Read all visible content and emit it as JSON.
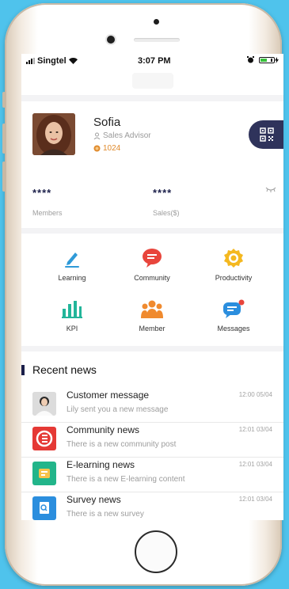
{
  "status": {
    "carrier": "Singtel",
    "time": "3:07 PM"
  },
  "profile": {
    "name": "Sofia",
    "role": "Sales Advisor",
    "points": "1024",
    "members_value": "****",
    "members_label": "Members",
    "sales_value": "****",
    "sales_label": "Sales($)"
  },
  "menu": [
    {
      "label": "Learning",
      "icon": "pencil-icon",
      "color": "#2f9ad8"
    },
    {
      "label": "Community",
      "icon": "chat-bubble-icon",
      "color": "#e8453c"
    },
    {
      "label": "Productivity",
      "icon": "badge-icon",
      "color": "#f4b820"
    },
    {
      "label": "KPI",
      "icon": "bar-chart-icon",
      "color": "#22b59a"
    },
    {
      "label": "Member",
      "icon": "people-icon",
      "color": "#f08a2e"
    },
    {
      "label": "Messages",
      "icon": "message-icon",
      "color": "#2b8ede"
    }
  ],
  "news": {
    "title": "Recent news",
    "items": [
      {
        "title": "Customer message",
        "subtitle": "Lily sent you a new message",
        "time": "12:00 05/04",
        "icon": "user-avatar-icon"
      },
      {
        "title": "Community news",
        "subtitle": "There is a new community post",
        "time": "12:01 03/04",
        "icon": "community-logo-icon"
      },
      {
        "title": "E-learning news",
        "subtitle": "There is a new E-learning content",
        "time": "12:01 03/04",
        "icon": "elearning-icon"
      },
      {
        "title": "Survey news",
        "subtitle": "There is a new survey",
        "time": "12:01 03/04",
        "icon": "survey-icon"
      }
    ]
  },
  "colors": {
    "accent": "#1b1f4a",
    "background": "#4fc3ec",
    "points": "#e08a2c"
  }
}
